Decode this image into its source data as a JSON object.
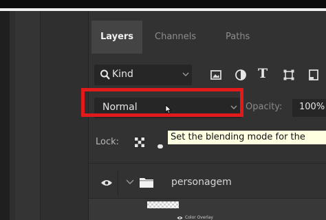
{
  "panel_tabs": [
    {
      "label": "Layers",
      "active": true
    },
    {
      "label": "Channels",
      "active": false
    },
    {
      "label": "Paths",
      "active": false
    }
  ],
  "filter": {
    "kind_label": "Kind",
    "icons": [
      "image-filter-icon",
      "adjustment-filter-icon",
      "type-filter-icon",
      "shape-filter-icon",
      "smart-object-filter-icon"
    ],
    "type_glyph": "T"
  },
  "blend": {
    "mode": "Normal",
    "opacity_label": "Opacity:",
    "opacity_value": "100%"
  },
  "lock": {
    "label": "Lock:"
  },
  "tooltip": "Set the blending mode for the",
  "layers": [
    {
      "name": "personagem",
      "type": "group",
      "visible": true,
      "expanded": false
    }
  ],
  "sub_layer": {
    "effect_label": "Color Overlay"
  },
  "colors": {
    "highlight": "#e11b1b",
    "tooltip_bg": "#ffffe1",
    "panel_bg": "#323232"
  }
}
